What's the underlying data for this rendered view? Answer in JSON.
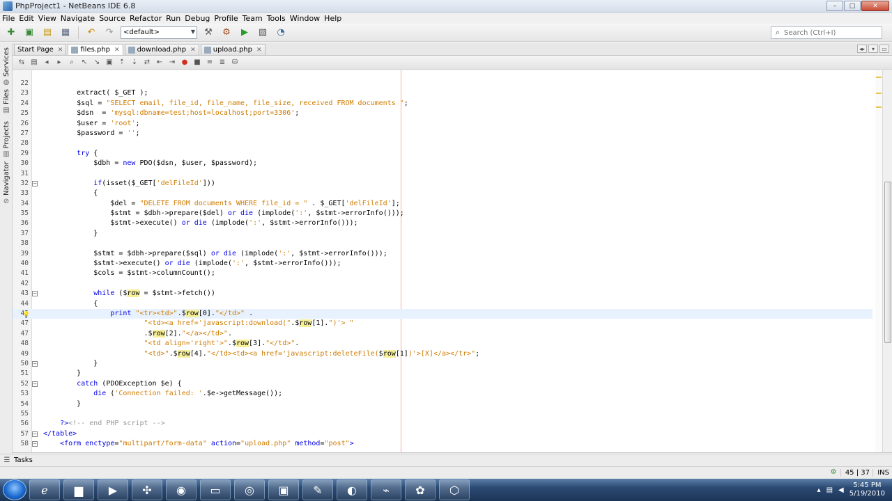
{
  "window": {
    "title": "PhpProject1 - NetBeans IDE 6.8",
    "controls": [
      "–",
      "□",
      "✕"
    ]
  },
  "menu": [
    "File",
    "Edit",
    "View",
    "Navigate",
    "Source",
    "Refactor",
    "Run",
    "Debug",
    "Profile",
    "Team",
    "Tools",
    "Window",
    "Help"
  ],
  "toolbar": {
    "config": "<default>",
    "search_placeholder": "Search (Ctrl+I)"
  },
  "sidebar": [
    "Services",
    "Files",
    "Projects",
    "Navigator"
  ],
  "tabs": [
    {
      "label": "Start Page",
      "active": false
    },
    {
      "label": "files.php",
      "active": true
    },
    {
      "label": "download.php",
      "active": false
    },
    {
      "label": "upload.php",
      "active": false
    }
  ],
  "code": [
    {
      "n": "22",
      "fold": false,
      "html": ""
    },
    {
      "n": "23",
      "html": "        extract( $_GET );"
    },
    {
      "n": "24",
      "html": "        $sql = <span class=\"str\">\"SELECT email, file_id, file_name, file_size, received FROM documents \"</span>;"
    },
    {
      "n": "25",
      "html": "        $dsn  = <span class=\"str\">'mysql:dbname=test;host=localhost;port=3306'</span>;"
    },
    {
      "n": "26",
      "html": "        $user = <span class=\"str\">'root'</span>;"
    },
    {
      "n": "27",
      "html": "        $password = <span class=\"str\">''</span>;"
    },
    {
      "n": "28",
      "html": ""
    },
    {
      "n": "29",
      "html": "        <span class=\"kw\">try</span> {"
    },
    {
      "n": "30",
      "html": "            $dbh = <span class=\"kw\">new</span> PDO($dsn, $user, $password);"
    },
    {
      "n": "31",
      "html": ""
    },
    {
      "n": "32",
      "fold": true,
      "html": "            <span class=\"kw\">if</span>(isset($_GET[<span class=\"str\">'delFileId'</span>]))"
    },
    {
      "n": "33",
      "html": "            {"
    },
    {
      "n": "34",
      "html": "                $del = <span class=\"str\">\"DELETE FROM documents WHERE file_id = \"</span> . $_GET[<span class=\"str\">'delFileId'</span>];"
    },
    {
      "n": "35",
      "html": "                $stmt = $dbh-&gt;prepare($del) <span class=\"kw\">or</span> <span class=\"kw\">die</span> (implode(<span class=\"str\">':'</span>, $stmt-&gt;errorInfo()));"
    },
    {
      "n": "36",
      "html": "                $stmt-&gt;execute() <span class=\"kw\">or</span> <span class=\"kw\">die</span> (implode(<span class=\"str\">':'</span>, $stmt-&gt;errorInfo()));"
    },
    {
      "n": "37",
      "html": "            }"
    },
    {
      "n": "38",
      "html": ""
    },
    {
      "n": "39",
      "html": "            $stmt = $dbh-&gt;prepare($sql) <span class=\"kw\">or</span> <span class=\"kw\">die</span> (implode(<span class=\"str\">':'</span>, $stmt-&gt;errorInfo()));"
    },
    {
      "n": "40",
      "html": "            $stmt-&gt;execute() <span class=\"kw\">or</span> <span class=\"kw\">die</span> (implode(<span class=\"str\">':'</span>, $stmt-&gt;errorInfo()));"
    },
    {
      "n": "41",
      "html": "            $cols = $stmt-&gt;columnCount();"
    },
    {
      "n": "42",
      "html": ""
    },
    {
      "n": "43",
      "fold": true,
      "html": "            <span class=\"kw\">while</span> ($<span class=\"hl\">row</span> = $stmt-&gt;fetch())"
    },
    {
      "n": "44",
      "html": "            {"
    },
    {
      "n": "45",
      "bulb": true,
      "cur": true,
      "html": "                <span class=\"kw\">print</span> <span class=\"str\">\"&lt;tr&gt;&lt;td&gt;\"</span>.$<span class=\"hl\">row</span>[0].<span class=\"str\">\"&lt;/td&gt;\"</span> ."
    },
    {
      "n": "47",
      "html": "                        <span class=\"str\">\"&lt;td&gt;&lt;a href='javascript:download(\"</span>.$<span class=\"hl\">row</span>[1].<span class=\"str\">\")'&gt; \"</span>"
    },
    {
      "n": "47",
      "html": "                        .$<span class=\"hl\">row</span>[2].<span class=\"str\">\"&lt;/a&gt;&lt;/td&gt;\"</span>."
    },
    {
      "n": "48",
      "html": "                        <span class=\"str\">\"&lt;td align='right'&gt;\"</span>.$<span class=\"hl\">row</span>[3].<span class=\"str\">\"&lt;/td&gt;\"</span>."
    },
    {
      "n": "49",
      "html": "                        <span class=\"str\">\"&lt;td&gt;\"</span>.$<span class=\"hl\">row</span>[4].<span class=\"str\">\"&lt;/td&gt;&lt;td&gt;&lt;a href='javascript:deleteFile(</span>$<span class=\"hl\">row</span>[1]<span class=\"str\">)'&gt;[X]&lt;/a&gt;&lt;/tr&gt;\"</span>;"
    },
    {
      "n": "50",
      "fold": true,
      "html": "            }"
    },
    {
      "n": "51",
      "html": "        }"
    },
    {
      "n": "52",
      "fold": true,
      "html": "        <span class=\"kw\">catch</span> (PDOException $e) {"
    },
    {
      "n": "53",
      "html": "            <span class=\"kw\">die</span> (<span class=\"str\">'Connection failed: '</span>.$e-&gt;getMessage());"
    },
    {
      "n": "54",
      "html": "        }"
    },
    {
      "n": "55",
      "html": ""
    },
    {
      "n": "56",
      "html": "    <span class=\"kw\">?&gt;</span><span class=\"cmt\">&lt;!-- end PHP script --&gt;</span>"
    },
    {
      "n": "57",
      "fold": true,
      "html": "<span class=\"tag\">&lt;/table&gt;</span>"
    },
    {
      "n": "58",
      "fold": true,
      "html": "    <span class=\"tag\">&lt;form</span> <span class=\"kw\">enctype</span>=<span class=\"str\">\"multipart/form-data\"</span> <span class=\"kw\">action</span>=<span class=\"str\">\"upload.php\"</span> <span class=\"kw\">method</span>=<span class=\"str\">\"post\"</span><span class=\"tag\">&gt;</span>"
    }
  ],
  "tasks_label": "Tasks",
  "status": {
    "position": "45 | 37",
    "mode": "INS"
  },
  "clock": {
    "time": "5:45 PM",
    "date": "5/19/2010"
  }
}
